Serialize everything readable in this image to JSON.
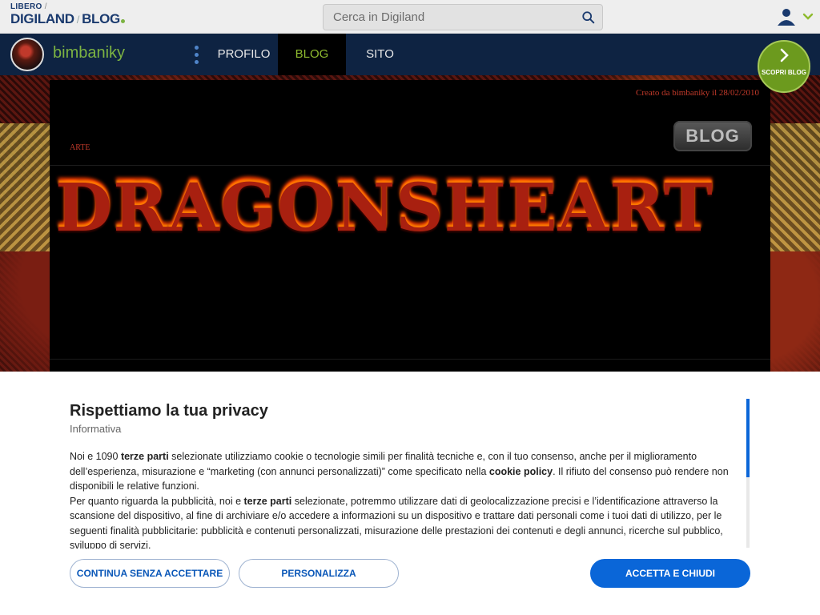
{
  "header": {
    "logo_top": "LIBERO",
    "logo_sep": "/",
    "logo_digiland": "DIGILAND",
    "logo_blog": "BLOG",
    "search_placeholder": "Cerca in Digiland"
  },
  "nav": {
    "username": "bimbaniky",
    "items": [
      "PROFILO",
      "BLOG",
      "SITO"
    ],
    "active": "BLOG",
    "scopri_label": "SCOPRI BLOG"
  },
  "blog": {
    "created": "Creato da bimbaniky il 28/02/2010",
    "category": "ARTE",
    "badge": "BLOG",
    "title": "DRAGONSHEART"
  },
  "privacy": {
    "title": "Rispettiamo la tua privacy",
    "subtitle": "Informativa",
    "p1_a": "Noi e 1090 ",
    "p1_b": "terze parti",
    "p1_c": " selezionate utilizziamo cookie o tecnologie simili per finalità tecniche e, con il tuo consenso, anche per il miglioramento dell’esperienza, misurazione e “marketing (con annunci personalizzati)” come specificato nella ",
    "p1_d": "cookie policy",
    "p1_e": ". Il rifiuto del consenso può rendere non disponibili le relative funzioni.",
    "p2_a": "Per quanto riguarda la pubblicità, noi e ",
    "p2_b": "terze parti",
    "p2_c": " selezionate, potremmo utilizzare dati di geolocalizzazione precisi e l’identificazione attraverso la scansione del dispositivo, al fine di archiviare e/o accedere a informazioni su un dispositivo e trattare dati personali come i tuoi dati di utilizzo, per le seguenti finalità pubblicitarie: pubblicità e contenuti personalizzati, misurazione delle prestazioni dei contenuti e degli annunci, ricerche sul pubblico, sviluppo di servizi.",
    "btn_reject": "CONTINUA SENZA ACCETTARE",
    "btn_customize": "PERSONALIZZA",
    "btn_accept": "ACCETTA E CHIUDI"
  },
  "colors": {
    "nav_bg": "#0e2342",
    "accent_green": "#7cb342",
    "primary_blue": "#0a66d8",
    "blog_red": "#c23a2a"
  },
  "icons": [
    "search-icon",
    "user-icon",
    "chevron-down-icon",
    "kebab-menu-icon",
    "chevron-right-icon"
  ]
}
